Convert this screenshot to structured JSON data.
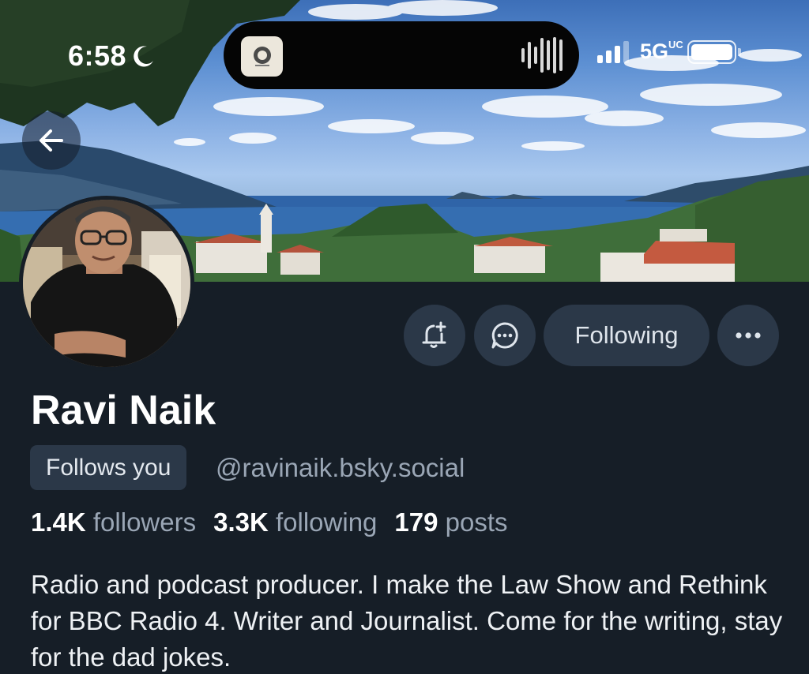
{
  "status_bar": {
    "time": "6:58",
    "network": "5G",
    "network_suffix": "UC",
    "moon_icon": "moon-icon",
    "signal_bars": 4,
    "signal_active_bars": 3
  },
  "header": {
    "back_icon": "arrow-left-icon"
  },
  "profile": {
    "name": "Ravi Naik",
    "follows_you_label": "Follows you",
    "handle": "@ravinaik.bsky.social",
    "stats": {
      "followers_count": "1.4K",
      "followers_label": "followers",
      "following_count": "3.3K",
      "following_label": "following",
      "posts_count": "179",
      "posts_label": "posts"
    },
    "bio": "Radio and podcast producer. I make the Law Show and Rethink for BBC Radio 4. Writer and Journalist. Come for the writing, stay for the dad jokes."
  },
  "actions": {
    "subscribe_icon": "bell-plus-icon",
    "message_icon": "chat-bubble-icon",
    "following_label": "Following",
    "more_icon": "ellipsis-icon"
  },
  "colors": {
    "background": "#161e27",
    "button_bg": "#2b3848",
    "muted_text": "#9aa6b5",
    "primary_text": "#ffffff"
  }
}
